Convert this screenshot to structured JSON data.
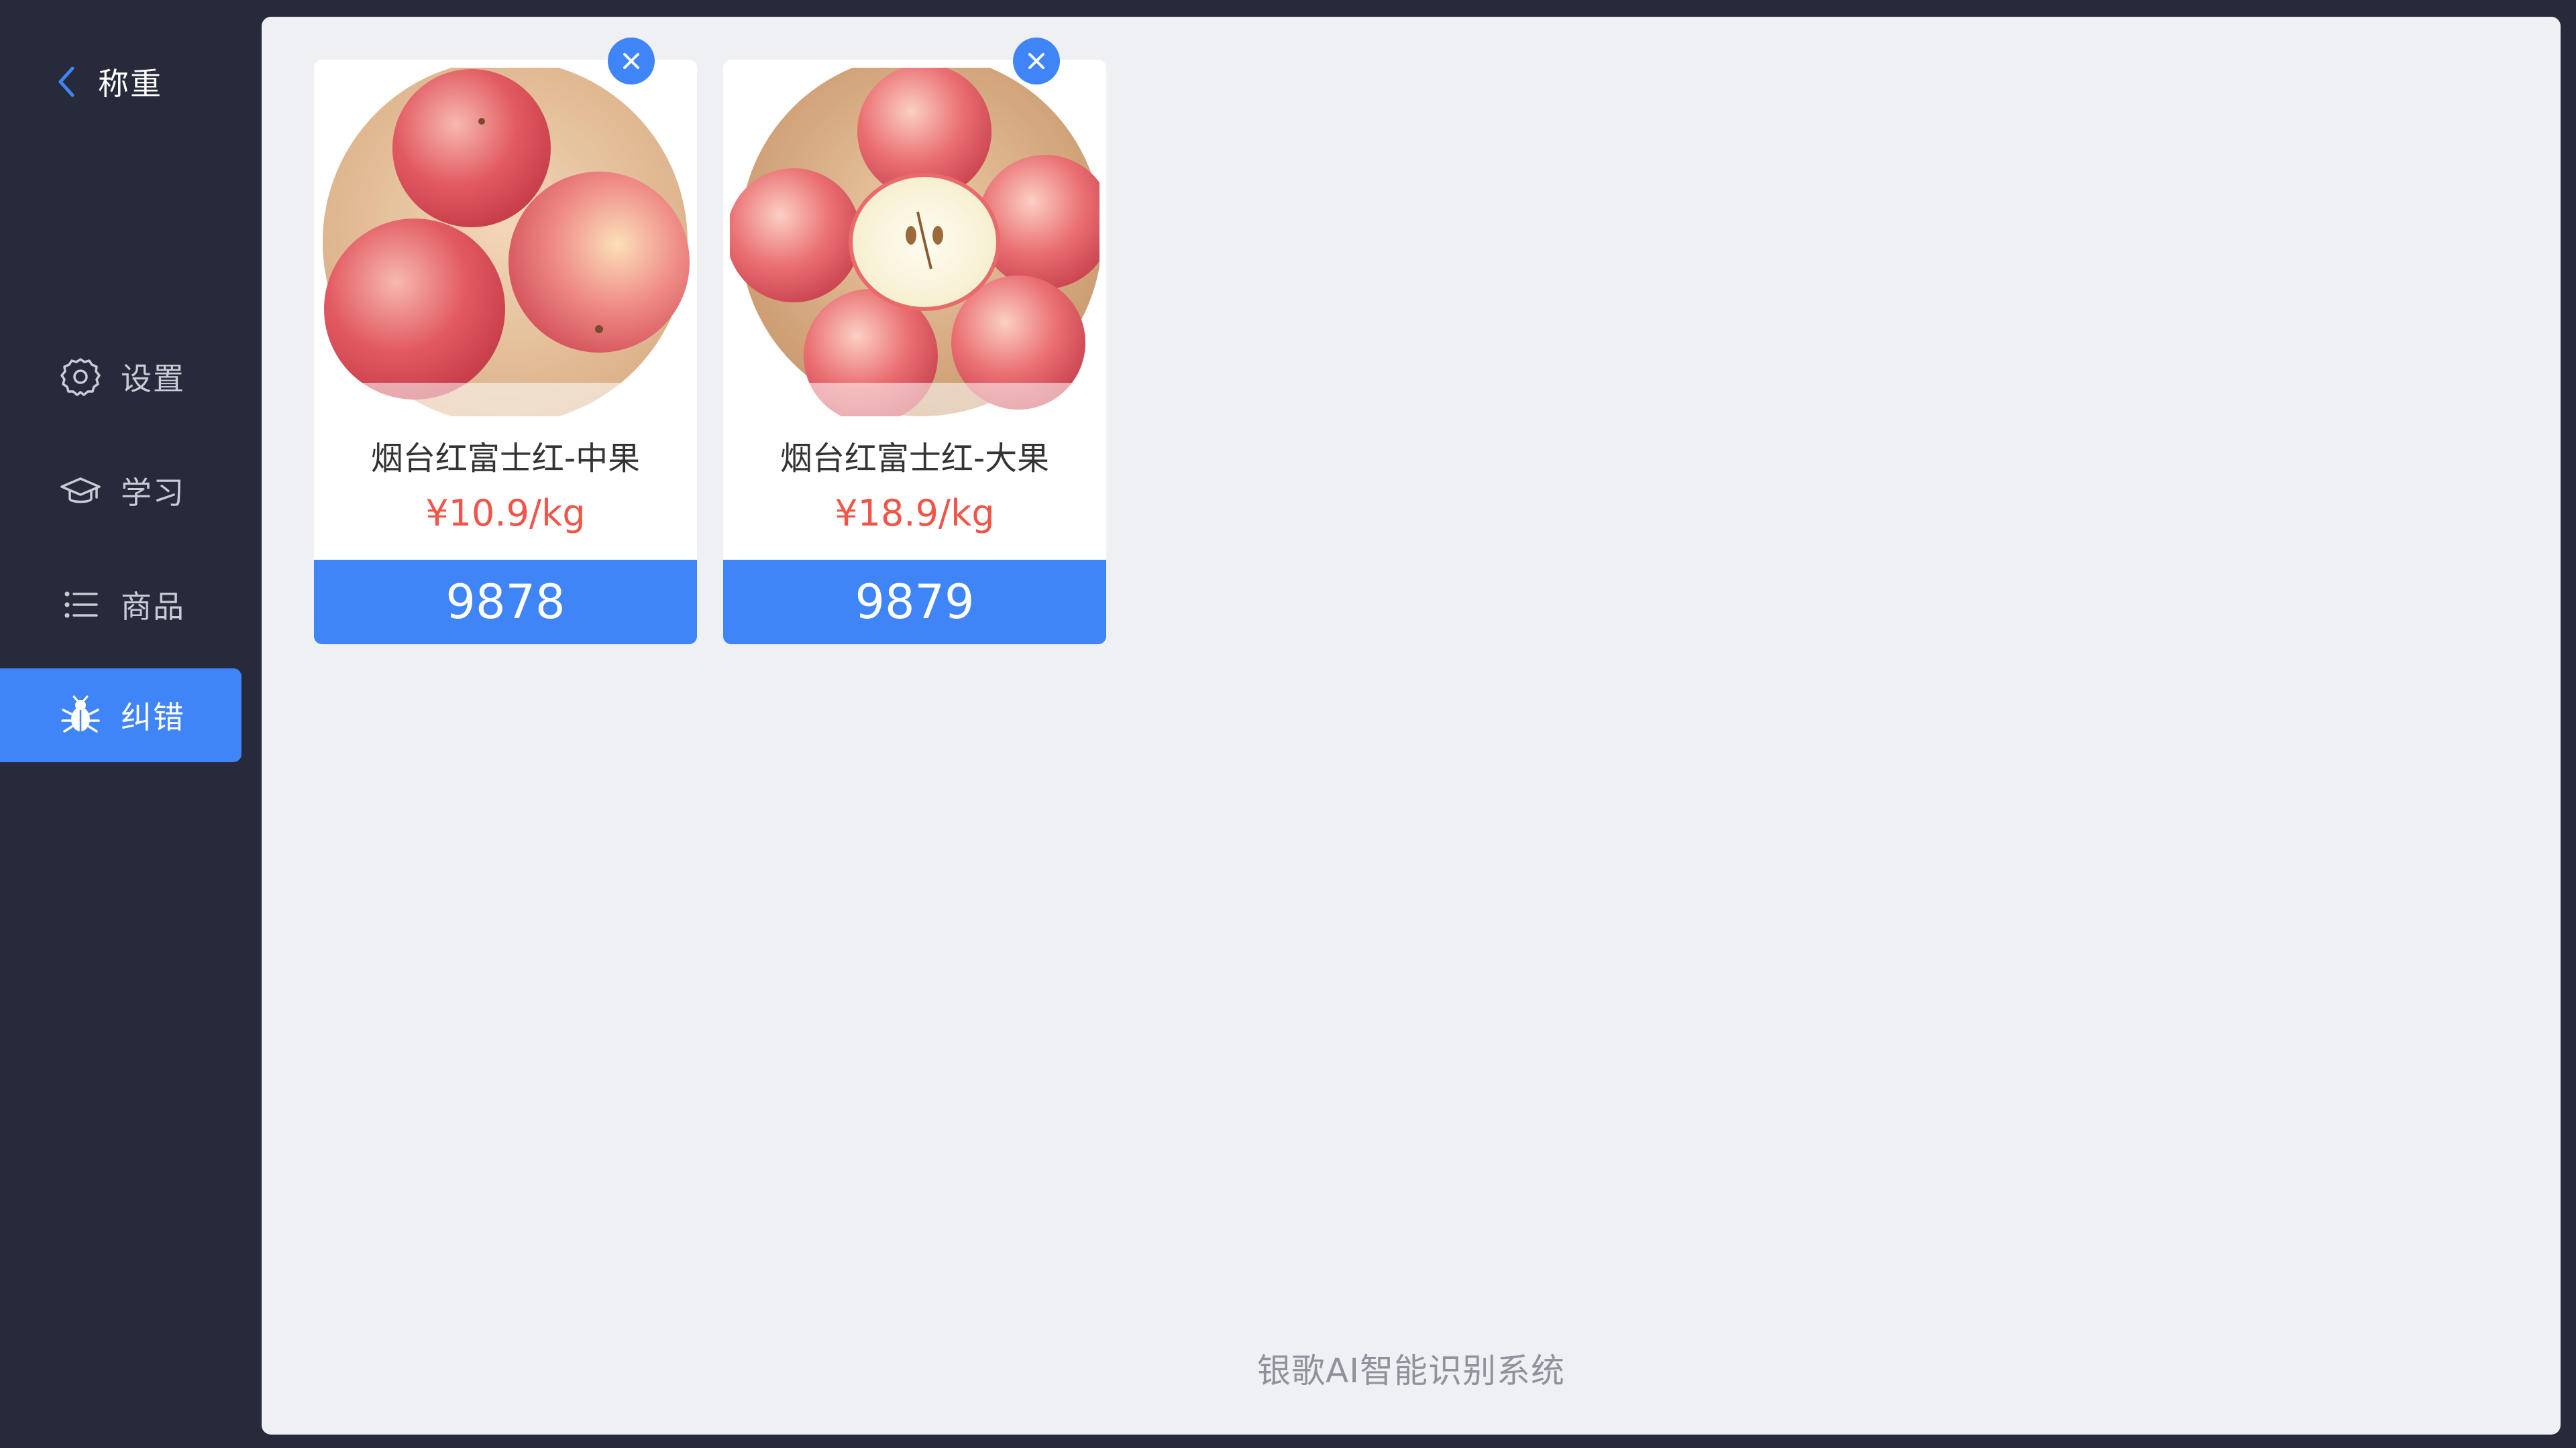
{
  "header": {
    "back_label": "称重"
  },
  "sidebar": {
    "items": [
      {
        "label": "设置",
        "icon": "gear-icon",
        "active": false
      },
      {
        "label": "学习",
        "icon": "graduation-cap-icon",
        "active": false
      },
      {
        "label": "商品",
        "icon": "list-icon",
        "active": false
      },
      {
        "label": "纠错",
        "icon": "bug-icon",
        "active": true
      }
    ]
  },
  "products": [
    {
      "name": "烟台红富士红-中果",
      "price": "¥10.9/kg",
      "code": "9878"
    },
    {
      "name": "烟台红富士红-大果",
      "price": "¥18.9/kg",
      "code": "9879"
    }
  ],
  "footer": {
    "text": "银歌AI智能识别系统"
  },
  "colors": {
    "sidebar_bg": "#262a3a",
    "accent": "#3f85f7",
    "price": "#f25548",
    "panel_bg": "#eff0f4"
  }
}
